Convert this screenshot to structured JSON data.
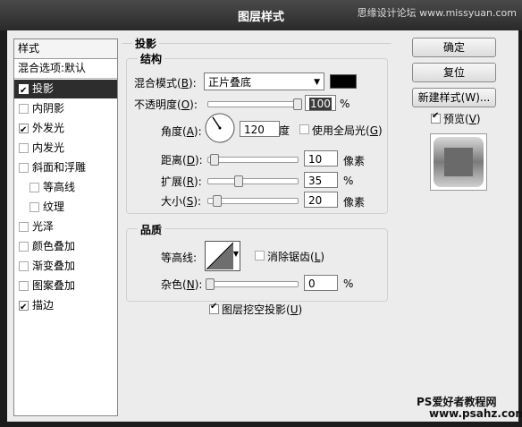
{
  "window": {
    "title": "图层样式",
    "watermark": "思缘设计论坛 www.missyuan.com"
  },
  "styles_panel": {
    "header": "样式",
    "blend_item": "混合选项:默认",
    "items": [
      {
        "label": "投影",
        "checked": true,
        "selected": true
      },
      {
        "label": "内阴影",
        "checked": false
      },
      {
        "label": "外发光",
        "checked": true
      },
      {
        "label": "内发光",
        "checked": false
      },
      {
        "label": "斜面和浮雕",
        "checked": false
      },
      {
        "label": "等高线",
        "checked": false
      },
      {
        "label": "纹理",
        "checked": false
      },
      {
        "label": "光泽",
        "checked": false
      },
      {
        "label": "颜色叠加",
        "checked": false
      },
      {
        "label": "渐变叠加",
        "checked": false
      },
      {
        "label": "图案叠加",
        "checked": false
      },
      {
        "label": "描边",
        "checked": true
      }
    ]
  },
  "drop_shadow": {
    "section_title": "投影",
    "structure_title": "结构",
    "blend_mode_label": "混合模式",
    "blend_mode_key": "B",
    "blend_mode_value": "正片叠底",
    "color": "#000000",
    "opacity_label": "不透明度",
    "opacity_key": "O",
    "opacity_value": "100",
    "opacity_unit": "%",
    "opacity_level": 1.0,
    "angle_label": "角度",
    "angle_key": "A",
    "angle_value": "120",
    "angle_unit": "度",
    "global_light_label": "使用全局光",
    "global_light_key": "G",
    "global_light_checked": false,
    "distance_label": "距离",
    "distance_key": "D",
    "distance_value": "10",
    "distance_unit": "像素",
    "distance_level": 0.03,
    "spread_label": "扩展",
    "spread_key": "R",
    "spread_value": "35",
    "spread_unit": "%",
    "spread_level": 0.35,
    "size_label": "大小",
    "size_key": "S",
    "size_value": "20",
    "size_unit": "像素",
    "size_level": 0.08
  },
  "quality": {
    "title": "品质",
    "contour_label": "等高线:",
    "antialias_label": "消除锯齿",
    "antialias_key": "L",
    "antialias_checked": false,
    "noise_label": "杂色",
    "noise_key": "N",
    "noise_value": "0",
    "noise_unit": "%",
    "noise_level": 0.0
  },
  "knockout": {
    "label": "图层挖空投影",
    "key": "U",
    "checked": true
  },
  "buttons": {
    "ok": "确定",
    "reset": "复位",
    "new_style": "新建样式(W)...",
    "preview_label": "预览",
    "preview_key": "V",
    "preview_checked": true
  },
  "footer_watermark": {
    "line1": "PS爱好者教程网",
    "line2": "www.psahz.com"
  }
}
